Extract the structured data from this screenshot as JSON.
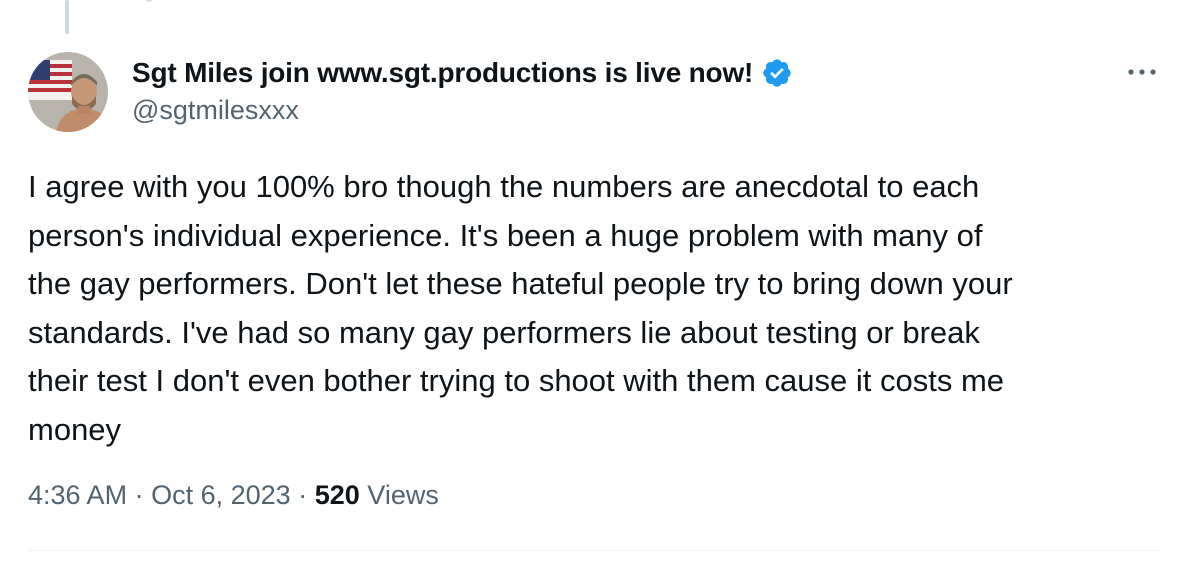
{
  "tweet": {
    "author": {
      "display_name": "Sgt Miles join www.sgt.productions is live now!",
      "handle": "@sgtmilesxxx",
      "verified": true,
      "avatar_icon": "user-avatar"
    },
    "lines": [
      "I agree with you 100% bro though the numbers are anecdotal to each",
      "person's individual experience.  It's been a huge problem with many of",
      "the gay performers.  Don't let these hateful people try to bring down your",
      "standards.  I've had so many gay performers lie about testing or break",
      "their test I don't even bother trying to shoot with them cause it costs me",
      "money"
    ],
    "time": "4:36 AM",
    "date": "Oct 6, 2023",
    "separator": "·",
    "views_count": "520",
    "views_label": "Views"
  },
  "icons": {
    "verified": "verified-badge-icon",
    "more": "more-options-icon"
  },
  "colors": {
    "text_primary": "#0f1419",
    "text_secondary": "#536471",
    "verified_blue": "#1d9bf0",
    "divider": "#eff3f4"
  }
}
